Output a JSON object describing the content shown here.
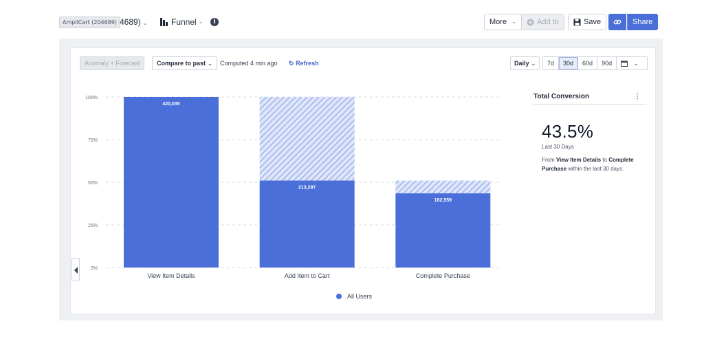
{
  "header": {
    "project_chip": "AmpliCart (204689)",
    "project_rest": "4689)",
    "chart_type": "Funnel",
    "more_label": "More",
    "add_to_label": "Add to",
    "save_label": "Save",
    "share_label": "Share"
  },
  "toolbar": {
    "anomaly_label": "Anomaly + Forecast",
    "compare_label": "Compare to past",
    "computed_text": "Computed 4 min ago",
    "refresh_label": "Refresh",
    "interval_label": "Daily",
    "ranges": [
      "7d",
      "30d",
      "60d",
      "90d"
    ],
    "active_range": "30d"
  },
  "chart_data": {
    "type": "bar",
    "categories": [
      "View Item Details",
      "Add Item to Cart",
      "Complete Purchase"
    ],
    "values": [
      100,
      51,
      43.5
    ],
    "dropoff_from": [
      null,
      100,
      51
    ],
    "value_labels": [
      "420,035",
      "213,297",
      "182,559"
    ],
    "series": [
      {
        "name": "All Users",
        "values": [
          100,
          51,
          43.5
        ]
      }
    ],
    "y_ticks": [
      "100%",
      "75%",
      "50%",
      "25%",
      "0%"
    ],
    "ylim": [
      0,
      100
    ],
    "grid": true,
    "legend": "bottom",
    "colors": {
      "bar": "#4a6fd8",
      "dropoff": "#b7c6f0"
    }
  },
  "legend": {
    "label": "All Users"
  },
  "sidebar": {
    "title": "Total Conversion",
    "value": "43.5%",
    "period": "Last 30 Days",
    "desc_from": "From ",
    "desc_start": "View Item Details",
    "desc_to": " to ",
    "desc_end": "Complete Purchase",
    "desc_tail": " within the last 30 days."
  }
}
